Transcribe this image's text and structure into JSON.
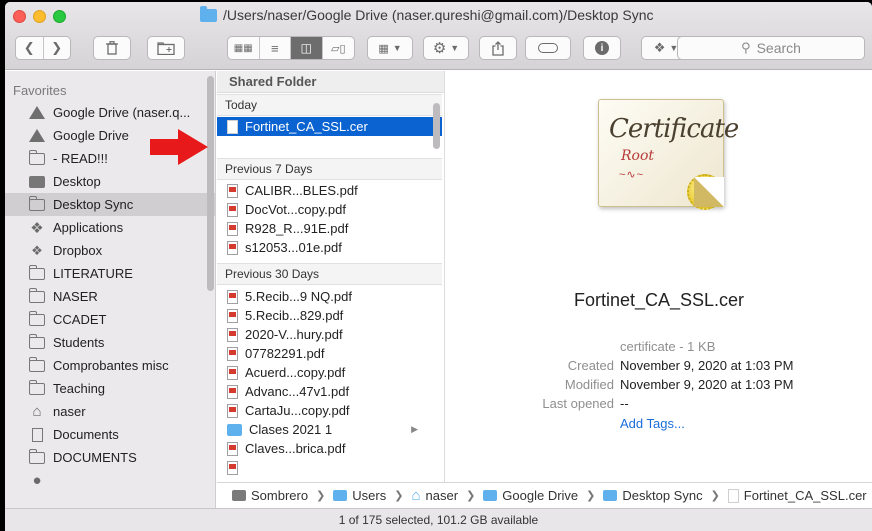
{
  "window": {
    "title": "/Users/naser/Google Drive (naser.qureshi@gmail.com)/Desktop Sync"
  },
  "toolbar": {
    "search_placeholder": "Search",
    "icons": [
      "chevron-left-icon",
      "chevron-right-icon",
      "trash-icon",
      "new-folder-icon",
      "icon-view-icon",
      "list-view-icon",
      "column-view-icon",
      "gallery-view-icon",
      "group-icon",
      "gear-icon",
      "share-icon",
      "tag-icon",
      "info-icon",
      "dropbox-icon",
      "search-icon"
    ]
  },
  "sidebar": {
    "heading": "Favorites",
    "items": [
      {
        "label": "Google Drive (naser.q...",
        "icon": "google-drive-icon"
      },
      {
        "label": "Google Drive",
        "icon": "google-drive-icon"
      },
      {
        "label": "- READ!!!",
        "icon": "folder-icon"
      },
      {
        "label": "Desktop",
        "icon": "desktop-icon"
      },
      {
        "label": "Desktop Sync",
        "icon": "folder-icon",
        "selected": true
      },
      {
        "label": "Applications",
        "icon": "applications-icon"
      },
      {
        "label": "Dropbox",
        "icon": "dropbox-icon"
      },
      {
        "label": "LITERATURE",
        "icon": "folder-icon"
      },
      {
        "label": "NASER",
        "icon": "folder-icon"
      },
      {
        "label": "CCADET",
        "icon": "folder-icon"
      },
      {
        "label": "Students",
        "icon": "folder-icon"
      },
      {
        "label": "Comprobantes misc",
        "icon": "folder-icon"
      },
      {
        "label": "Teaching",
        "icon": "folder-icon"
      },
      {
        "label": "naser",
        "icon": "home-icon"
      },
      {
        "label": "Documents",
        "icon": "documents-icon"
      },
      {
        "label": "DOCUMENTS",
        "icon": "folder-icon"
      }
    ]
  },
  "column": {
    "header": "Shared Folder",
    "sections": {
      "today": "Today",
      "prev7": "Previous 7 Days",
      "prev30": "Previous 30 Days"
    },
    "today_files": [
      "Fortinet_CA_SSL.cer"
    ],
    "prev7_files": [
      "CALIBR...BLES.pdf",
      "DocVot...copy.pdf",
      "R928_R...91E.pdf",
      "s12053...01e.pdf"
    ],
    "prev30_files": [
      {
        "label": "5.Recib...9 NQ.pdf",
        "type": "pdf"
      },
      {
        "label": "5.Recib...829.pdf",
        "type": "pdf"
      },
      {
        "label": "2020-V...hury.pdf",
        "type": "pdf"
      },
      {
        "label": "07782291.pdf",
        "type": "pdf"
      },
      {
        "label": "Acuerd...copy.pdf",
        "type": "pdf"
      },
      {
        "label": "Advanc...47v1.pdf",
        "type": "pdf"
      },
      {
        "label": "CartaJu...copy.pdf",
        "type": "pdf"
      },
      {
        "label": "Clases 2021 1",
        "type": "folder"
      },
      {
        "label": "Claves...brica.pdf",
        "type": "pdf"
      }
    ]
  },
  "preview": {
    "cert_title": "Certificate",
    "cert_root": "Root",
    "filename": "Fortinet_CA_SSL.cer",
    "kind": "certificate - 1 KB",
    "created_label": "Created",
    "created_value": "November 9, 2020 at 1:03 PM",
    "modified_label": "Modified",
    "modified_value": "November 9, 2020 at 1:03 PM",
    "last_opened_label": "Last opened",
    "last_opened_value": "--",
    "add_tags": "Add Tags..."
  },
  "pathbar": [
    "Sombrero",
    "Users",
    "naser",
    "Google Drive",
    "Desktop Sync",
    "Fortinet_CA_SSL.cer"
  ],
  "status": "1 of 175 selected, 101.2 GB available",
  "colors": {
    "selection": "#0a63d1",
    "folder": "#5fb1ee",
    "arrow": "#e8191b",
    "link": "#1a6ed8"
  }
}
